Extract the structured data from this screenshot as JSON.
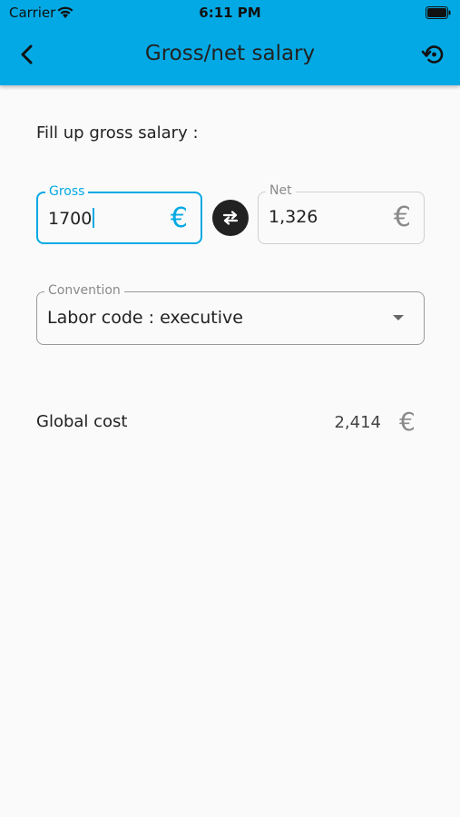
{
  "status_bar": {
    "carrier": "Carrier",
    "time": "6:11 PM"
  },
  "app_bar": {
    "title": "Gross/net salary"
  },
  "form": {
    "prompt": "Fill up gross salary :",
    "gross": {
      "label": "Gross",
      "value": "1700",
      "currency": "€"
    },
    "net": {
      "label": "Net",
      "value": "1,326",
      "currency": "€"
    },
    "convention": {
      "label": "Convention",
      "value": "Labor code : executive"
    }
  },
  "result": {
    "label": "Global cost",
    "value": "2,414",
    "currency": "€"
  },
  "colors": {
    "accent": "#03a9e4",
    "background": "#fafafa",
    "swap_button": "#222222"
  }
}
